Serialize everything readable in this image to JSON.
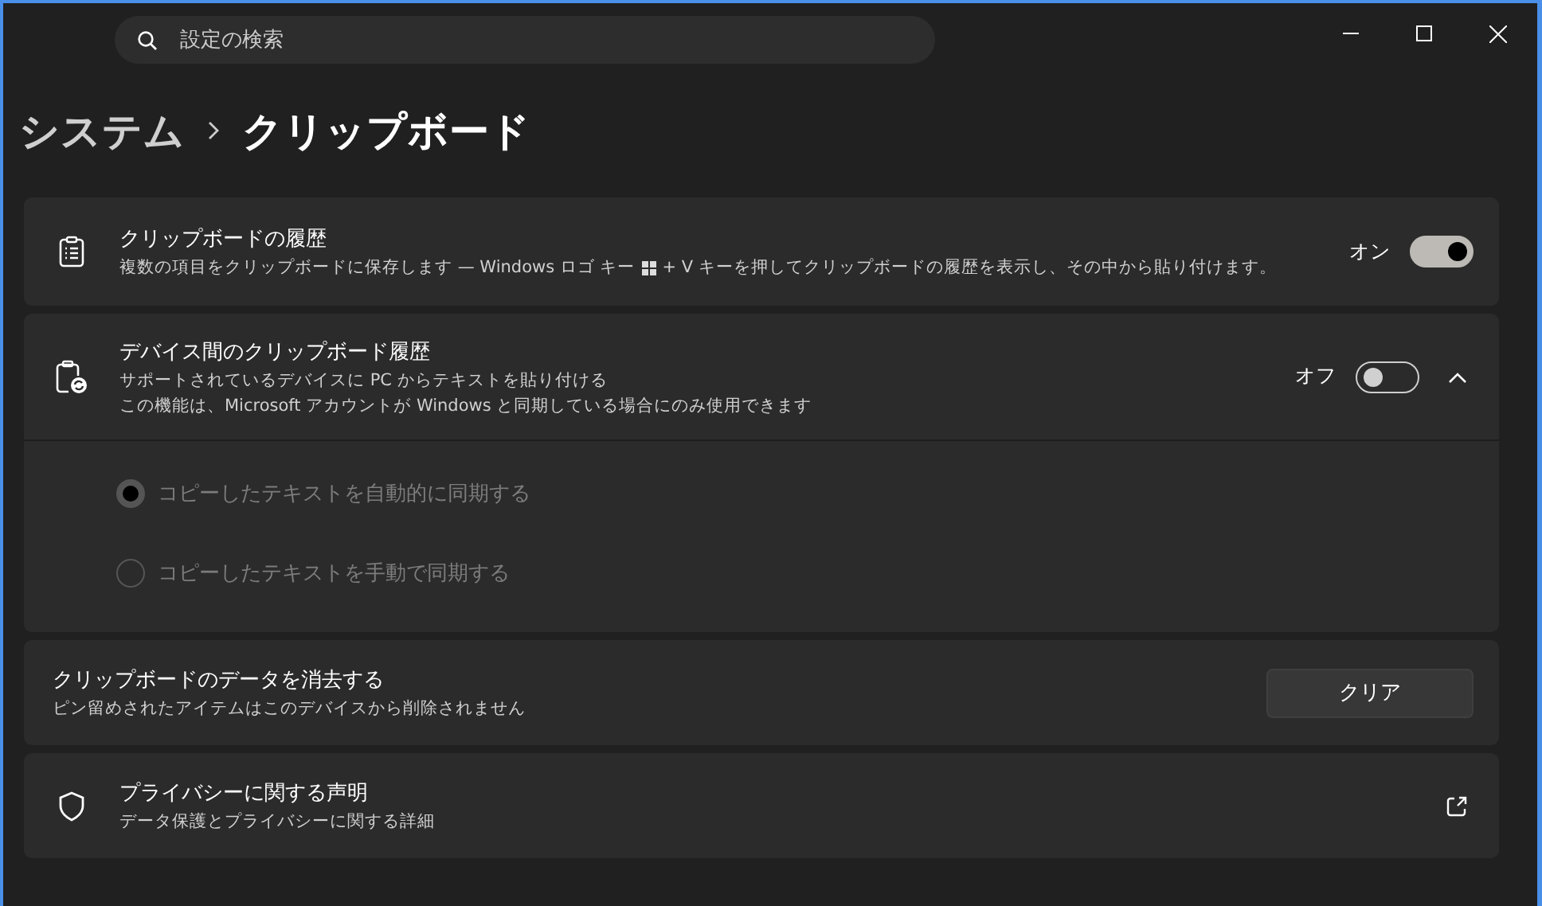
{
  "search": {
    "placeholder": "設定の検索"
  },
  "breadcrumb": [
    {
      "label": "システム",
      "current": false
    },
    {
      "label": "クリップボード",
      "current": true
    }
  ],
  "history": {
    "title": "クリップボードの履歴",
    "description_parts": [
      "複数の項目をクリップボードに保存します — Windows ロゴ キー",
      "+ V キーを押してクリップボードの履歴を表示し、その中から貼り付けます。"
    ],
    "toggle_label": "オン",
    "on": true
  },
  "sync": {
    "title": "デバイス間のクリップボード履歴",
    "description": [
      "サポートされているデバイスに PC からテキストを貼り付ける",
      "この機能は、Microsoft アカウントが Windows と同期している場合にのみ使用できます"
    ],
    "toggle_label": "オフ",
    "on": false,
    "expanded": true,
    "options": [
      {
        "label": "コピーしたテキストを自動的に同期する",
        "selected": true,
        "disabled": true
      },
      {
        "label": "コピーしたテキストを手動で同期する",
        "selected": false,
        "disabled": true
      }
    ]
  },
  "clear": {
    "title": "クリップボードのデータを消去する",
    "description": "ピン留めされたアイテムはこのデバイスから削除されません",
    "button": "クリア"
  },
  "privacy": {
    "title": "プライバシーに関する声明",
    "description": "データ保護とプライバシーに関する詳細"
  }
}
